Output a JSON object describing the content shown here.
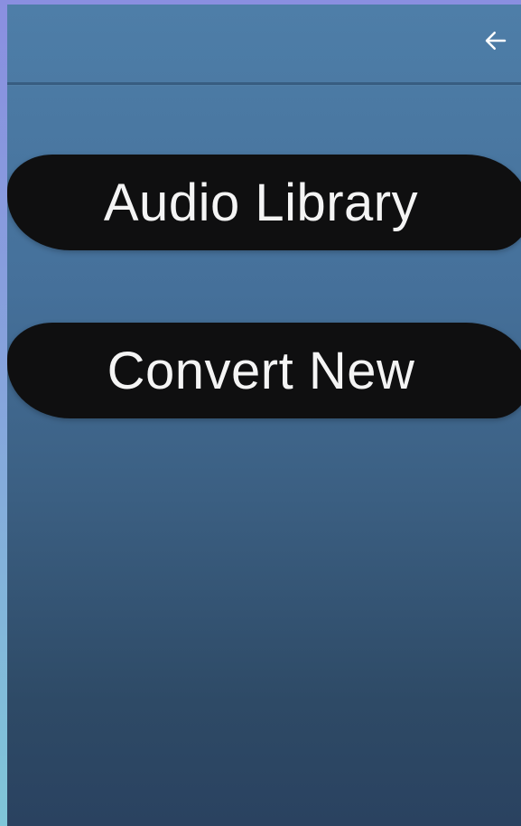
{
  "app_bar": {
    "back_icon": "arrow-left-icon"
  },
  "menu": {
    "audio_library_label": "Audio Library",
    "convert_new_label": "Convert New"
  },
  "colors": {
    "button_background": "#0f0f10",
    "button_text": "#f4f4f4",
    "background_top": "#4e7ea8",
    "background_bottom": "#2a4260"
  }
}
